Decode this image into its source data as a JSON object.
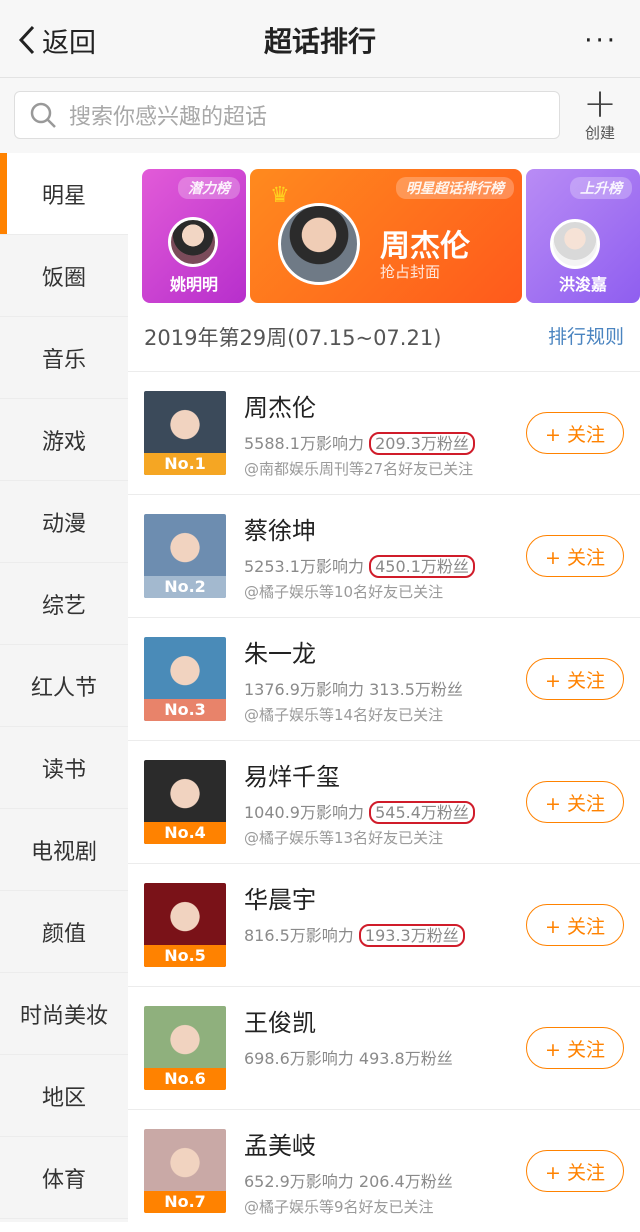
{
  "nav": {
    "back_label": "返回",
    "title": "超话排行",
    "more": "···"
  },
  "search": {
    "placeholder": "搜索你感兴趣的超话",
    "create_label": "创建"
  },
  "sidebar": {
    "items": [
      {
        "label": "明星",
        "active": true
      },
      {
        "label": "饭圈"
      },
      {
        "label": "音乐"
      },
      {
        "label": "游戏"
      },
      {
        "label": "动漫"
      },
      {
        "label": "综艺"
      },
      {
        "label": "红人节"
      },
      {
        "label": "读书"
      },
      {
        "label": "电视剧"
      },
      {
        "label": "颜值"
      },
      {
        "label": "时尚美妆"
      },
      {
        "label": "地区"
      },
      {
        "label": "体育"
      }
    ]
  },
  "banners": {
    "left": {
      "tag": "潜力榜",
      "name": "姚明明"
    },
    "mid": {
      "tag": "明星超话排行榜",
      "name": "周杰伦",
      "sub": "抢占封面"
    },
    "right": {
      "tag": "上升榜",
      "name": "洪浚嘉"
    }
  },
  "week": {
    "label": "2019年第29周(07.15~07.21)",
    "rules": "排行规则"
  },
  "follow_label": "+ 关注",
  "ranks": [
    {
      "rank": "No.1",
      "name": "周杰伦",
      "influence": "5588.1万影响力",
      "fans": "209.3万粉丝",
      "friends": "@南都娱乐周刊等27名好友已关注",
      "circled": true,
      "color": "#f5a623"
    },
    {
      "rank": "No.2",
      "name": "蔡徐坤",
      "influence": "5253.1万影响力",
      "fans": "450.1万粉丝",
      "friends": "@橘子娱乐等10名好友已关注",
      "circled": true,
      "color": "#a3b9cf"
    },
    {
      "rank": "No.3",
      "name": "朱一龙",
      "influence": "1376.9万影响力",
      "fans": "313.5万粉丝",
      "friends": "@橘子娱乐等14名好友已关注",
      "circled": false,
      "color": "#e8836a"
    },
    {
      "rank": "No.4",
      "name": "易烊千玺",
      "influence": "1040.9万影响力",
      "fans": "545.4万粉丝",
      "friends": "@橘子娱乐等13名好友已关注",
      "circled": true,
      "color": "#ff8200"
    },
    {
      "rank": "No.5",
      "name": "华晨宇",
      "influence": "816.5万影响力",
      "fans": "193.3万粉丝",
      "friends": "",
      "circled": true,
      "color": "#ff8200"
    },
    {
      "rank": "No.6",
      "name": "王俊凯",
      "influence": "698.6万影响力",
      "fans": "493.8万粉丝",
      "friends": "",
      "circled": false,
      "color": "#ff8200"
    },
    {
      "rank": "No.7",
      "name": "孟美岐",
      "influence": "652.9万影响力",
      "fans": "206.4万粉丝",
      "friends": "@橘子娱乐等9名好友已关注",
      "circled": false,
      "color": "#ff8200"
    }
  ]
}
